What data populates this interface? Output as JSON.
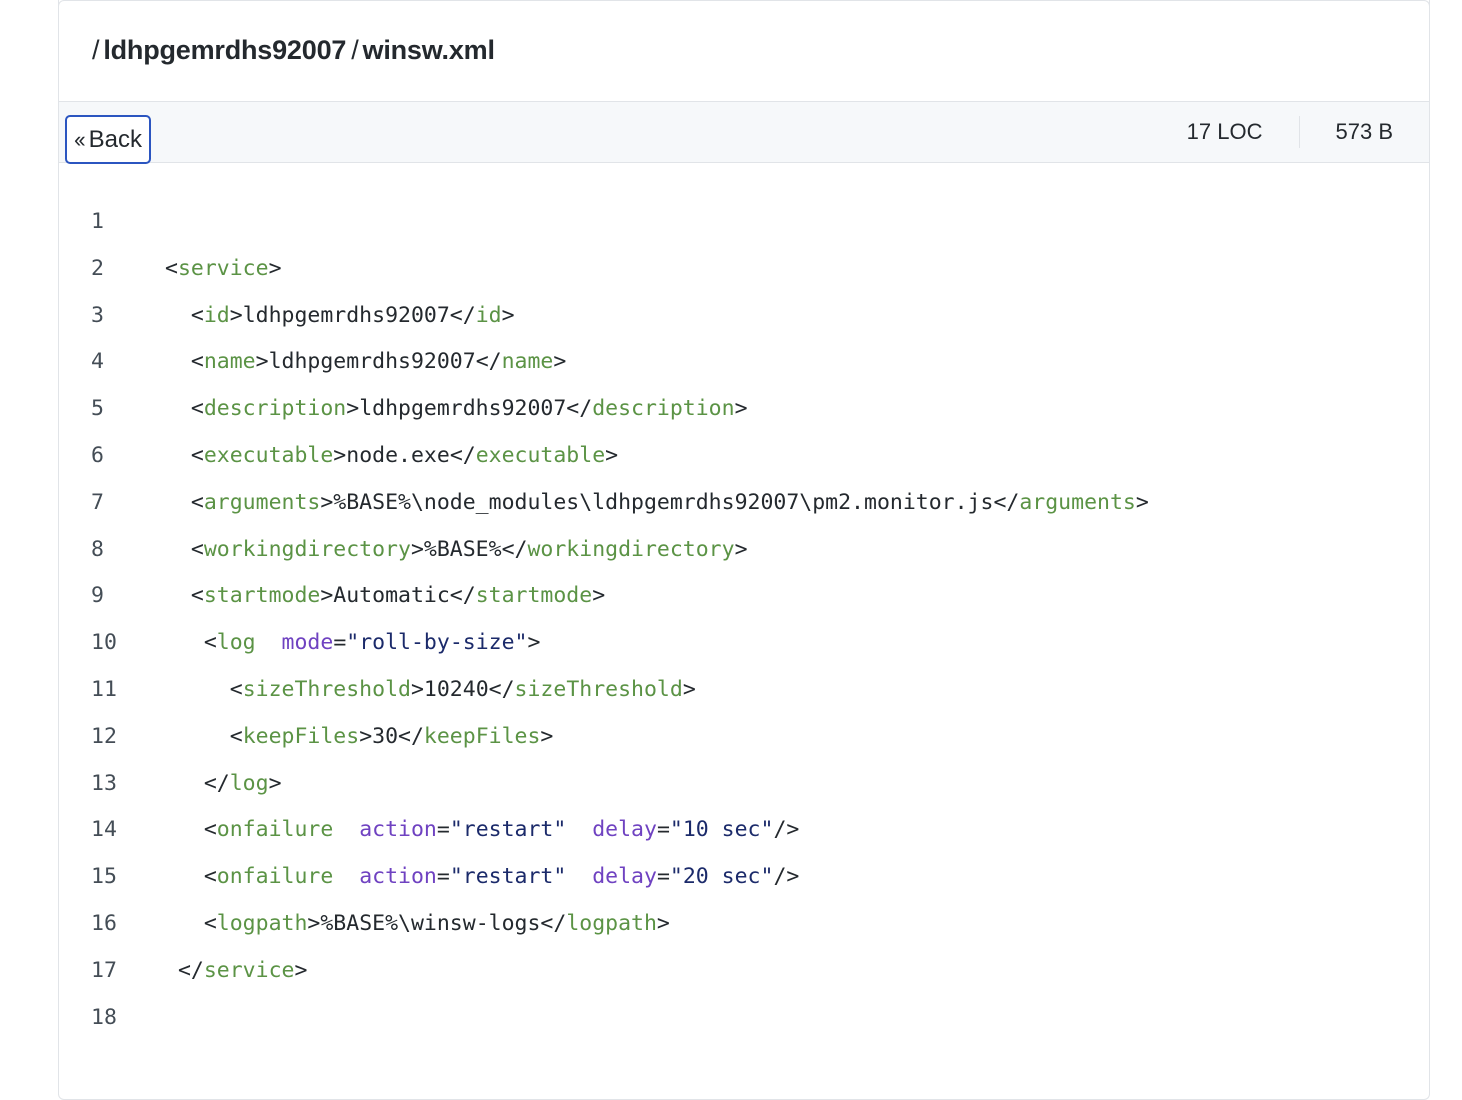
{
  "header": {
    "path_sep": "/",
    "repo": "ldhpgemrdhs92007",
    "file": "winsw.xml"
  },
  "toolbar": {
    "back_icon": "double-chevron-left-icon",
    "back_label": "Back",
    "loc": "17 LOC",
    "size": "573 B"
  },
  "code": {
    "language": "xml",
    "lines": [
      {
        "n": "1",
        "text": ""
      },
      {
        "n": "2",
        "text": "<service>"
      },
      {
        "n": "3",
        "text": "  <id>ldhpgemrdhs92007</id>"
      },
      {
        "n": "4",
        "text": "  <name>ldhpgemrdhs92007</name>"
      },
      {
        "n": "5",
        "text": "  <description>ldhpgemrdhs92007</description>"
      },
      {
        "n": "6",
        "text": "  <executable>node.exe</executable>"
      },
      {
        "n": "7",
        "text": "  <arguments>%BASE%\\node_modules\\ldhpgemrdhs92007\\pm2.monitor.js</arguments>"
      },
      {
        "n": "8",
        "text": "  <workingdirectory>%BASE%</workingdirectory>"
      },
      {
        "n": "9",
        "text": "  <startmode>Automatic</startmode>"
      },
      {
        "n": "10",
        "text": "   <log mode=\"roll-by-size\">"
      },
      {
        "n": "11",
        "text": "     <sizeThreshold>10240</sizeThreshold>"
      },
      {
        "n": "12",
        "text": "     <keepFiles>30</keepFiles>"
      },
      {
        "n": "13",
        "text": "   </log>"
      },
      {
        "n": "14",
        "text": "   <onfailure action=\"restart\" delay=\"10 sec\"/>"
      },
      {
        "n": "15",
        "text": "   <onfailure action=\"restart\" delay=\"20 sec\"/>"
      },
      {
        "n": "16",
        "text": "   <logpath>%BASE%\\winsw-logs</logpath>"
      },
      {
        "n": "17",
        "text": " </service>"
      },
      {
        "n": "18",
        "text": ""
      }
    ]
  },
  "colors": {
    "tag": "#5b9345",
    "attr": "#6f42c1",
    "string": "#1b2a6a",
    "focus_border": "#2b55c0"
  }
}
